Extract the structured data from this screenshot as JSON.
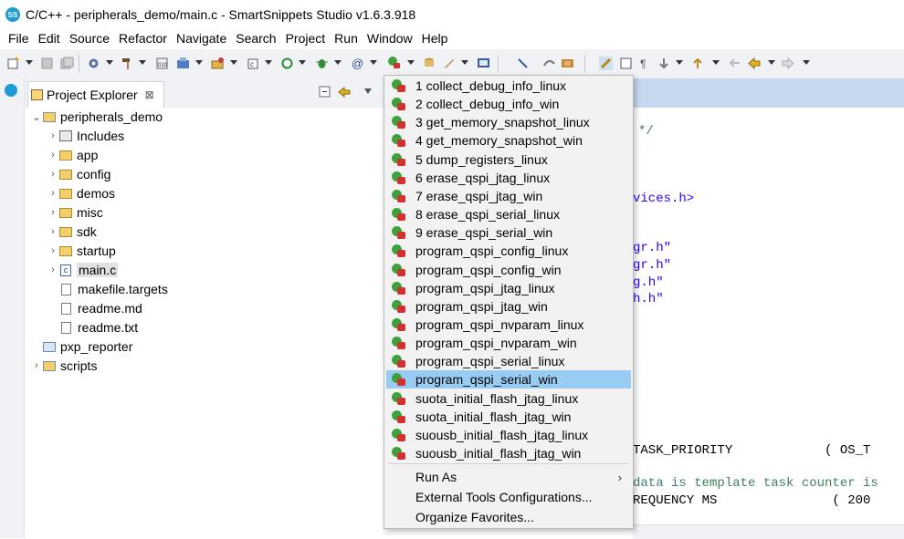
{
  "window": {
    "title": "C/C++ - peripherals_demo/main.c - SmartSnippets Studio v1.6.3.918",
    "logo_text": "SS"
  },
  "menubar": [
    "File",
    "Edit",
    "Source",
    "Refactor",
    "Navigate",
    "Search",
    "Project",
    "Run",
    "Window",
    "Help"
  ],
  "explorer": {
    "tab_label": "Project Explorer",
    "tab_close": "⊠",
    "tree": [
      {
        "label": "peripherals_demo",
        "type": "project",
        "expanded": true
      },
      {
        "label": "Includes",
        "type": "includes"
      },
      {
        "label": "app",
        "type": "folder"
      },
      {
        "label": "config",
        "type": "folder"
      },
      {
        "label": "demos",
        "type": "folder"
      },
      {
        "label": "misc",
        "type": "folder"
      },
      {
        "label": "sdk",
        "type": "folder"
      },
      {
        "label": "startup",
        "type": "folder"
      },
      {
        "label": "main.c",
        "type": "cfile",
        "selected": true
      },
      {
        "label": "makefile.targets",
        "type": "file"
      },
      {
        "label": "readme.md",
        "type": "file"
      },
      {
        "label": "readme.txt",
        "type": "file"
      },
      {
        "label": "pxp_reporter",
        "type": "project-closed"
      },
      {
        "label": "scripts",
        "type": "project"
      }
    ]
  },
  "dropdown_menu": {
    "items": [
      "1 collect_debug_info_linux",
      "2 collect_debug_info_win",
      "3 get_memory_snapshot_linux",
      "4 get_memory_snapshot_win",
      "5 dump_registers_linux",
      "6 erase_qspi_jtag_linux",
      "7 erase_qspi_jtag_win",
      "8 erase_qspi_serial_linux",
      "9 erase_qspi_serial_win",
      "program_qspi_config_linux",
      "program_qspi_config_win",
      "program_qspi_jtag_linux",
      "program_qspi_jtag_win",
      "program_qspi_nvparam_linux",
      "program_qspi_nvparam_win",
      "program_qspi_serial_linux",
      "program_qspi_serial_win",
      "suota_initial_flash_jtag_linux",
      "suota_initial_flash_jtag_win",
      "suousb_initial_flash_jtag_linux",
      "suousb_initial_flash_jtag_win"
    ],
    "selected_index": 16,
    "run_as": "Run As",
    "run_as_arrow": "›",
    "external_tools": "External Tools Configurations...",
    "organize": "Organize Favorites..."
  },
  "editor": {
    "lines": [
      {
        "text": "*/",
        "kind": "cmt"
      },
      {
        "text": "vices.h>",
        "kind": "str"
      },
      {
        "text": "gr.h\"",
        "kind": "str"
      },
      {
        "text": "gr.h\"",
        "kind": "str"
      },
      {
        "text": "g.h\"",
        "kind": "str"
      },
      {
        "text": "h.h\"",
        "kind": "str"
      },
      {
        "text": "TASK_PRIORITY            ( OS_T",
        "kind": "code"
      },
      {
        "text": "data is template task counter is",
        "kind": "cmt"
      },
      {
        "text": "REQUENCY MS               ( 200",
        "kind": "code"
      }
    ]
  },
  "colors": {
    "accent": "#1e9bd6",
    "menu_selection": "#99ccf3",
    "highlight": "#e00000",
    "editor_tab": "#c5d8ef"
  }
}
